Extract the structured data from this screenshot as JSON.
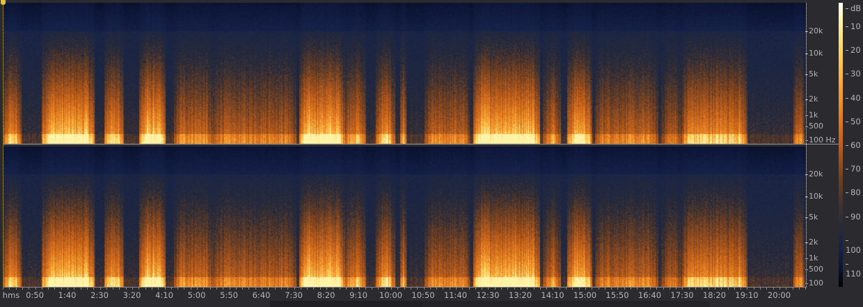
{
  "view": "spectral-frequency-display",
  "time_axis": {
    "unit_label": "hms",
    "labels": [
      "0:50",
      "1:40",
      "2:30",
      "3:20",
      "4:10",
      "5:00",
      "5:50",
      "6:40",
      "7:30",
      "8:20",
      "9:10",
      "10:00",
      "10:50",
      "11:40",
      "12:30",
      "13:20",
      "14:10",
      "15:00",
      "15:50",
      "16:40",
      "17:30",
      "18:20",
      "19:10",
      "20:00"
    ]
  },
  "channels": [
    {
      "freq_labels": [
        "20k",
        "10k",
        "5k",
        "2k",
        "1k",
        "500",
        "100 Hz"
      ]
    },
    {
      "freq_labels": [
        "20k",
        "10k",
        "5k",
        "2k",
        "1k",
        "500",
        "100"
      ]
    }
  ],
  "db_scale": {
    "unit_label": "dB",
    "labels": [
      "10",
      "20",
      "30",
      "40",
      "50",
      "60",
      "70",
      "80",
      "90",
      "100",
      "110"
    ]
  },
  "colors": {
    "playhead": "#e8c22a",
    "background": "#2a2a2f"
  }
}
